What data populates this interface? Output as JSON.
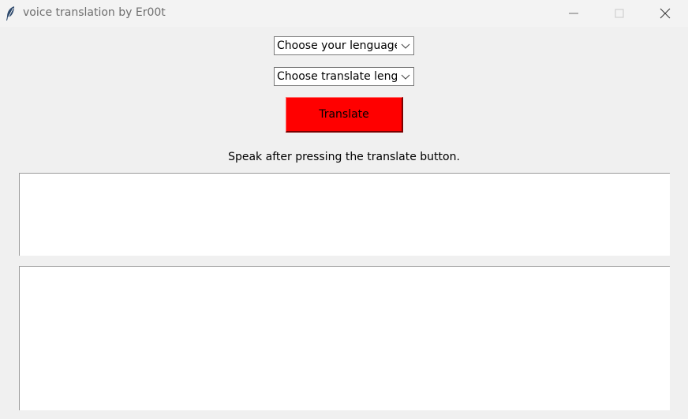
{
  "window": {
    "title": "voice translation by Er00t",
    "app_icon": "feather-icon",
    "controls": [
      "minimize-icon",
      "maximize-icon",
      "close-icon"
    ]
  },
  "source_language_select": {
    "selected": "Choose your lenguage"
  },
  "target_language_select": {
    "selected": "Choose translate lenguage"
  },
  "translate_button": {
    "label": "Translate",
    "color": "#ff0000"
  },
  "hint_text": "Speak after pressing the translate button.",
  "source_text": "",
  "translated_text": ""
}
